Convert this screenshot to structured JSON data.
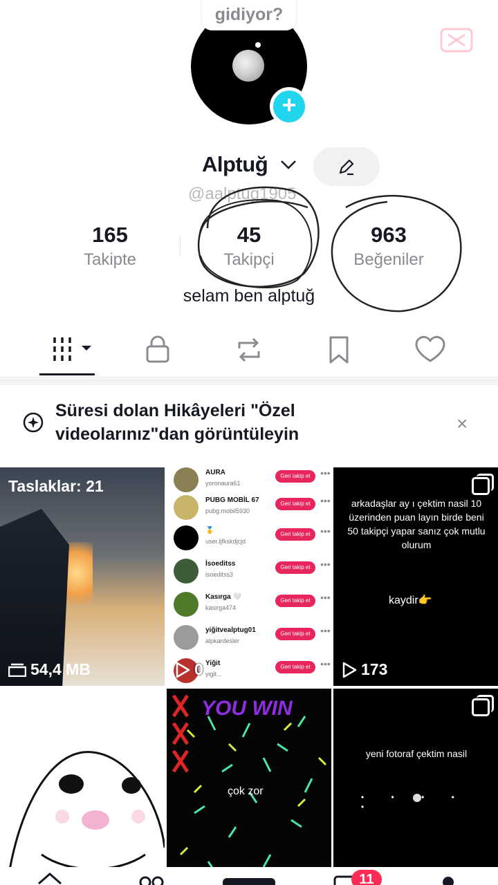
{
  "story": {
    "bubble_text": "gidiyor?"
  },
  "profile": {
    "name": "Alptuğ",
    "handle": "@aalptug1905",
    "bio": "selam ben alptuğ"
  },
  "stats": [
    {
      "number": "165",
      "label": "Takipte"
    },
    {
      "number": "45",
      "label": "Takipçi"
    },
    {
      "number": "963",
      "label": "Beğeniler"
    }
  ],
  "tabs": [
    {
      "name": "videos",
      "icon": "grid-icon"
    },
    {
      "name": "private",
      "icon": "lock-icon"
    },
    {
      "name": "reposts",
      "icon": "repost-icon"
    },
    {
      "name": "saved",
      "icon": "bookmark-icon"
    },
    {
      "name": "liked",
      "icon": "heart-icon"
    }
  ],
  "banner": {
    "text": "Süresi dolan Hikâyeleri \"Özel videolarınız\"dan görüntüleyin",
    "close": "×"
  },
  "grid": {
    "drafts": {
      "title": "Taslaklar: 21",
      "size": "54,4 MB"
    },
    "follow_video": {
      "views": "0",
      "rows": [
        {
          "name": "AURA",
          "sub": "yoronaura61",
          "btn": "Geri takip et"
        },
        {
          "name": "PUBG MOBİL 67",
          "sub": "pubg.mobil5930",
          "btn": "Geri takip et"
        },
        {
          "name": "🥇",
          "sub": "user.ljfkskdjcjd",
          "btn": "Geri takip et"
        },
        {
          "name": "İsoeditss",
          "sub": "isoeditss3",
          "btn": "Geri takip et"
        },
        {
          "name": "Kasırga 🤍",
          "sub": "kasirga474",
          "btn": "Geri takip et"
        },
        {
          "name": "yiğitvealptug01",
          "sub": "alpkardesler",
          "btn": "Geri takip et"
        },
        {
          "name": "Yiğit",
          "sub": "yigit...",
          "btn": "Geri takip et"
        }
      ]
    },
    "text_video": {
      "text": "arkadaşlar ay ı çektim nasil 10 üzerinden puan layın birde beni 50 takipçi yapar sanız çok mutlu olurum",
      "swipe": "kaydir👉",
      "views": "173"
    },
    "game_video": {
      "title": "YOU WIN",
      "caption": "çok zor"
    },
    "photo_post": {
      "text": "yeni fotoraf çektim nasil",
      "dots": "• • • • •"
    }
  },
  "nav": {
    "inbox_badge": "11"
  }
}
